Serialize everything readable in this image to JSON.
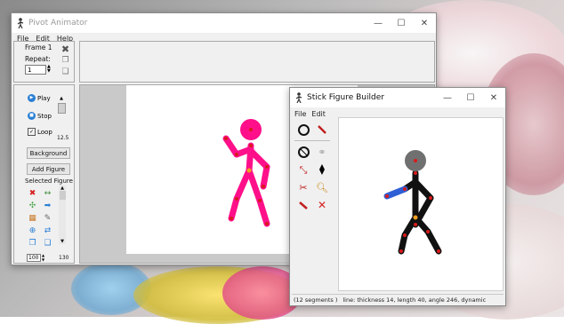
{
  "main": {
    "title": "Pivot Animator",
    "menu": [
      "File",
      "Edit",
      "Help"
    ],
    "frame_label": "Frame 1",
    "repeat_label": "Repeat:",
    "repeat_value": "1",
    "play": "Play",
    "stop": "Stop",
    "loop": "Loop",
    "speed": "12.5",
    "background": "Background",
    "add_figure": "Add Figure",
    "selected_figure": "Selected Figure",
    "bottom_value": "100",
    "bottom_number": "130"
  },
  "builder": {
    "title": "Stick Figure Builder",
    "menu": [
      "File",
      "Edit"
    ],
    "status_segments": "(12 segments )",
    "status_info": "line: thickness 14, length 40, angle 246, dynamic"
  },
  "colors": {
    "figure_main": "#ff0f8a",
    "figure_builder": "#111111",
    "head_builder": "#707070",
    "joint": "#d81a1a",
    "selected": "#2f5fd6"
  }
}
